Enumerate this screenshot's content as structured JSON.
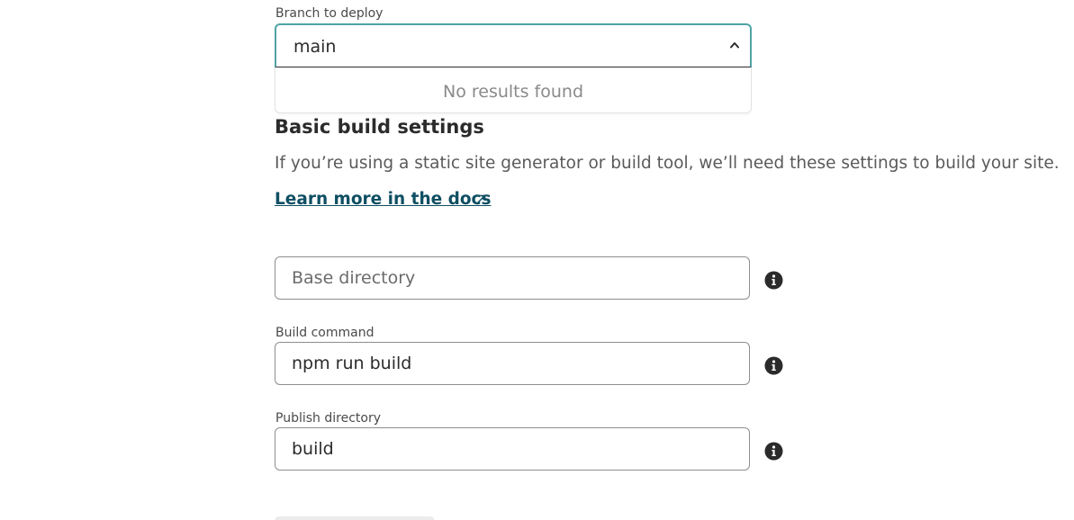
{
  "branch": {
    "label": "Branch to deploy",
    "value": "main",
    "no_results": "No results found"
  },
  "build_settings": {
    "title": "Basic build settings",
    "description": "If you’re using a static site generator or build tool, we’ll need these settings to build your site.",
    "docs_link": "Learn more in the docs",
    "base_directory": {
      "placeholder": "Base directory",
      "value": ""
    },
    "build_command": {
      "label": "Build command",
      "value": "npm run build"
    },
    "publish_directory": {
      "label": "Publish directory",
      "value": "build"
    }
  },
  "colors": {
    "focus_border": "#4fa3a5",
    "link": "#0f4f63",
    "icon": "#2b2b2b"
  },
  "icons": {
    "combo_toggle": "chevron-up-icon",
    "docs_external": "external-link-arrow-icon",
    "field_help": "info-icon"
  }
}
